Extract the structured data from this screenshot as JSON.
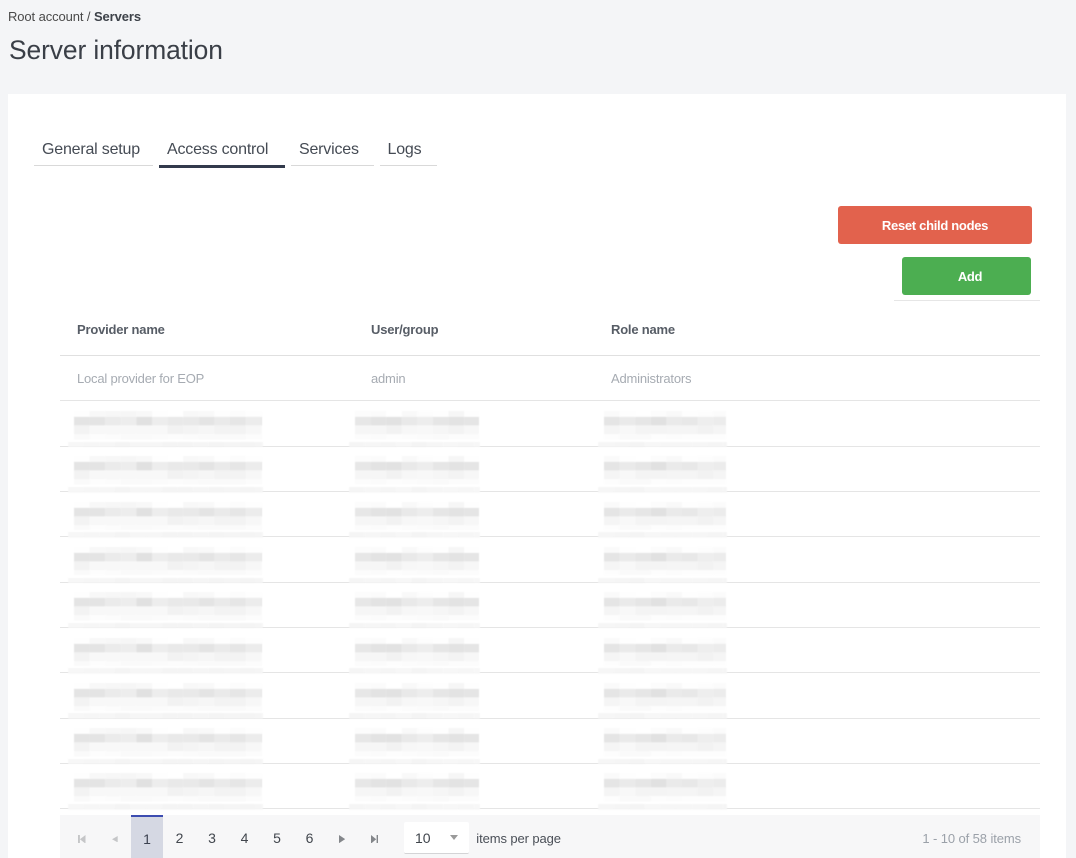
{
  "breadcrumb": {
    "root": "Root account",
    "separator": " / ",
    "current": "Servers"
  },
  "title": "Server information",
  "tabs": [
    {
      "label": "General setup",
      "active": false
    },
    {
      "label": "Access control",
      "active": true
    },
    {
      "label": "Services",
      "active": false
    },
    {
      "label": "Logs",
      "active": false
    }
  ],
  "toolbar": {
    "reset_label": "Reset child nodes",
    "add_label": "Add",
    "reset_color": "#e2624d",
    "add_color": "#4cae51"
  },
  "table": {
    "columns": [
      "Provider name",
      "User/group",
      "Role name"
    ],
    "rows": [
      {
        "redacted": false,
        "provider": "Local provider for EOP",
        "user": "admin",
        "role": "Administrators"
      },
      {
        "redacted": true
      },
      {
        "redacted": true
      },
      {
        "redacted": true
      },
      {
        "redacted": true
      },
      {
        "redacted": true
      },
      {
        "redacted": true
      },
      {
        "redacted": true
      },
      {
        "redacted": true
      },
      {
        "redacted": true
      }
    ]
  },
  "pager": {
    "pages": [
      "1",
      "2",
      "3",
      "4",
      "5",
      "6"
    ],
    "current_page": "1",
    "page_size": "10",
    "items_per_page_label": "items per page",
    "info": "1 - 10 of 58 items",
    "accent_color": "#3c4cb0"
  }
}
